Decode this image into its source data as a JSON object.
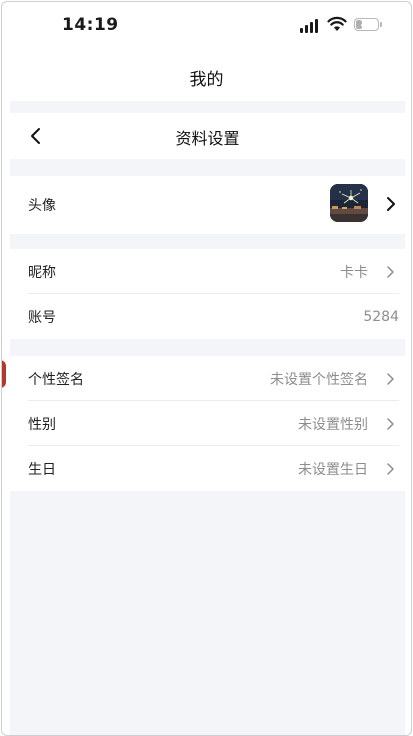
{
  "status_bar": {
    "time": "14:19",
    "battery_level": "25"
  },
  "top_title": "我的",
  "nav": {
    "title": "资料设置"
  },
  "profile": {
    "avatar_label": "头像",
    "nickname_label": "昵称",
    "nickname_value": "卡卡",
    "account_label": "账号",
    "account_value": "5284",
    "signature_label": "个性签名",
    "signature_value": "未设置个性签名",
    "gender_label": "性别",
    "gender_value": "未设置性别",
    "birthday_label": "生日",
    "birthday_value": "未设置生日"
  },
  "colors": {
    "page_bg": "#f4f5f9",
    "card_bg": "#ffffff",
    "secondary_text": "#8d8d8d"
  }
}
